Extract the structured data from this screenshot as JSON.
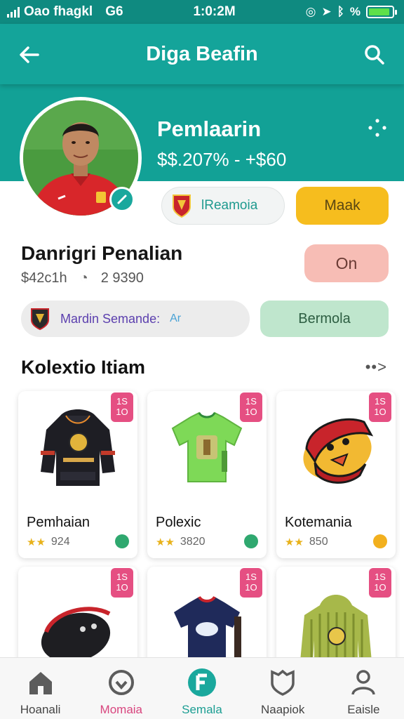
{
  "status_bar": {
    "carrier": "Oao fhagkl",
    "network": "G6",
    "time": "1:0:2M",
    "battery_percent": "%",
    "battery_level": 0.9
  },
  "app_bar": {
    "title": "Diga Beafin",
    "back_icon": "arrow-left-icon",
    "search_icon": "search-icon"
  },
  "profile": {
    "name": "Pemlaarin",
    "price": "$$.207% - +$60",
    "team_chip_label": "lReamoia",
    "mark_button": "Maak",
    "player_name": "Danrigri Penalian",
    "stat_1": "$42c1h",
    "stat_2": "2 9390",
    "on_button": "On",
    "user_chip_label": "Mardin Semande:",
    "user_chip_suffix": "Ar",
    "bermola_button": "Bermola"
  },
  "collection": {
    "title": "Kolextio Itiam",
    "more": "••>",
    "items": [
      {
        "badge": "1S 1O",
        "title": "Pemhaian",
        "stars": "★★",
        "count": "924",
        "coin_color": "#2fa86f",
        "image": "hoodie-icon"
      },
      {
        "badge": "1S 1O",
        "title": "Polexic",
        "stars": "★★",
        "count": "3820",
        "coin_color": "#2fa86f",
        "image": "green-jersey-icon"
      },
      {
        "badge": "1S 1O",
        "title": "Kotemania",
        "stars": "★★",
        "count": "850",
        "coin_color": "#f2b01e",
        "image": "goalkeeper-glove-icon"
      },
      {
        "badge": "1S 1O",
        "title": "",
        "stars": "",
        "count": "",
        "coin_color": "",
        "image": "glove-icon"
      },
      {
        "badge": "1S 1O",
        "title": "",
        "stars": "",
        "count": "",
        "coin_color": "",
        "image": "navy-jersey-icon"
      },
      {
        "badge": "1S 1O",
        "title": "",
        "stars": "",
        "count": "",
        "coin_color": "",
        "image": "striped-hoodie-icon"
      }
    ]
  },
  "nav": [
    {
      "label": "Hoanali",
      "icon": "home-icon"
    },
    {
      "label": "Momaia",
      "icon": "ball-icon"
    },
    {
      "label": "Semala",
      "icon": "f-icon"
    },
    {
      "label": "Naapiok",
      "icon": "shield-icon"
    },
    {
      "label": "Eaisle",
      "icon": "profile-icon"
    }
  ],
  "colors": {
    "primary": "#14a49a",
    "accent_yellow": "#f6bd1e",
    "accent_pink": "#e54f82",
    "chip_green": "#bfe6cd",
    "chip_salmon": "#f7bdb5"
  }
}
